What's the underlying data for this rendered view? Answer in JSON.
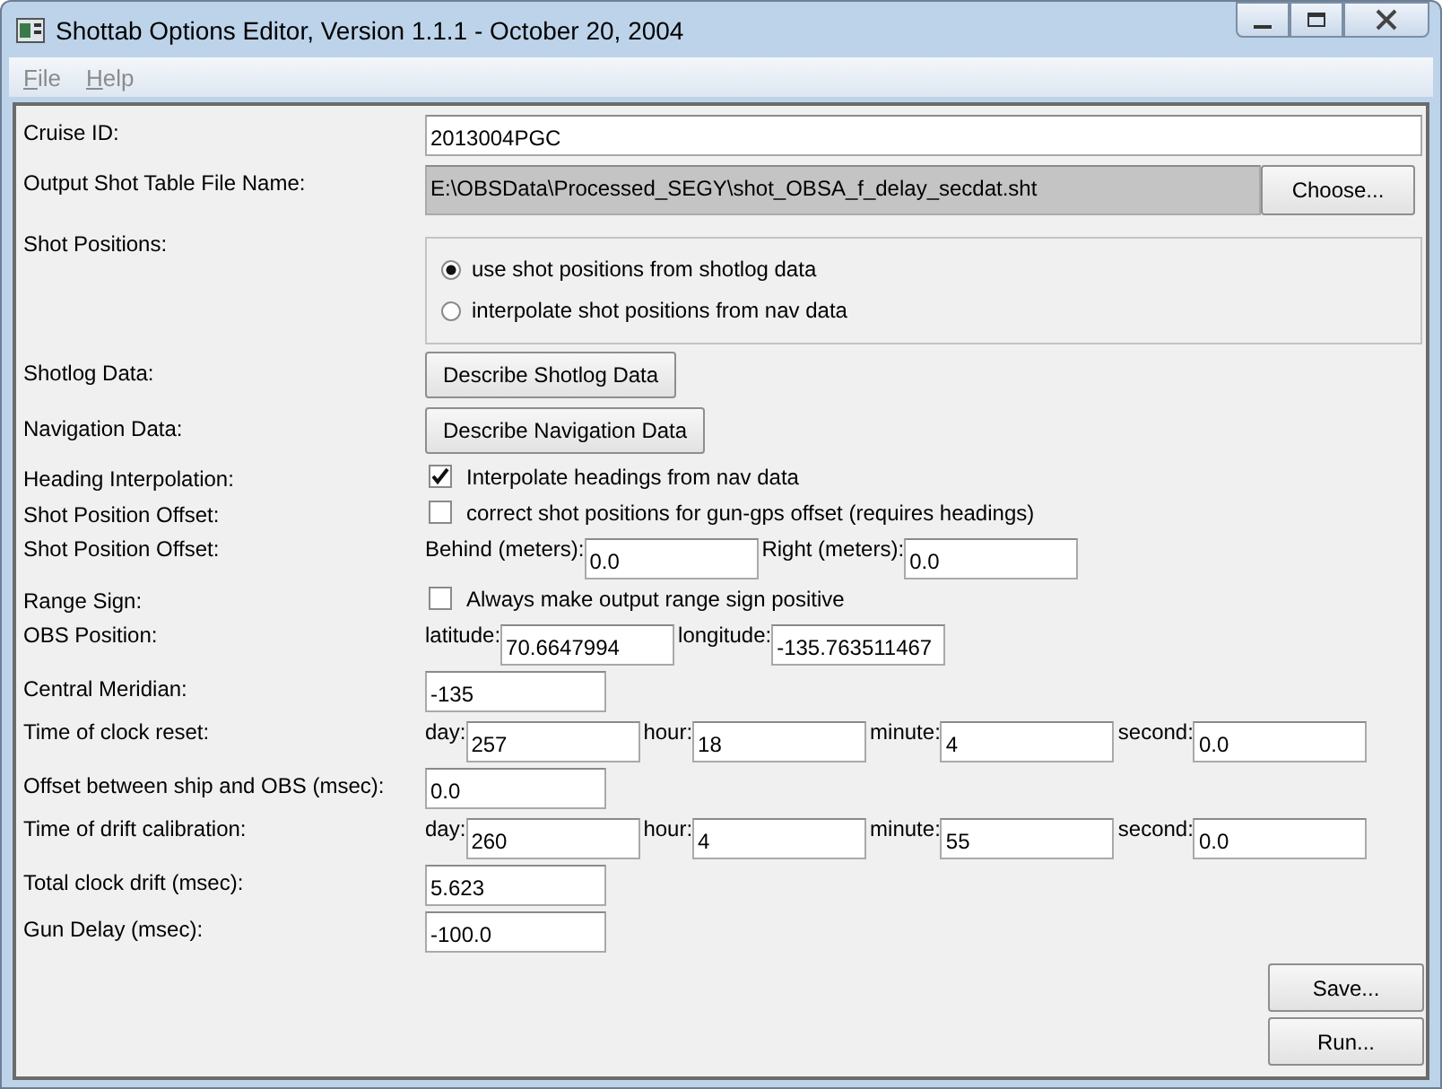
{
  "window": {
    "title": "Shottab Options Editor, Version 1.1.1 - October 20, 2004"
  },
  "menu": [
    "File",
    "Help"
  ],
  "rows": [
    {
      "kind": "long_field",
      "label": "Cruise ID:",
      "value": "2013004PGC"
    },
    {
      "kind": "file",
      "label": "Output Shot Table File Name:",
      "value": "E:\\OBSData\\Processed_SEGY\\shot_OBSA_f_delay_secdat.sht",
      "button": "Choose..."
    },
    {
      "kind": "radio",
      "label": "Shot Positions:",
      "options": [
        {
          "label": "use shot positions from shotlog data",
          "selected": true
        },
        {
          "label": "interpolate shot positions from nav data",
          "selected": false
        }
      ]
    },
    {
      "kind": "button",
      "label": "Shotlog Data:",
      "button": "Describe Shotlog Data"
    },
    {
      "kind": "button",
      "label": "Navigation Data:",
      "button": "Describe Navigation Data"
    },
    {
      "kind": "check",
      "label": "Heading Interpolation:",
      "text": "Interpolate headings from nav data",
      "checked": true
    },
    {
      "kind": "check",
      "label": "Shot Position Offset:",
      "text": "correct shot positions for gun-gps offset (requires headings)",
      "checked": false
    },
    {
      "kind": "fields",
      "label": "Shot Position Offset:",
      "parts": [
        {
          "prefix": "Behind (meters):",
          "value": "0.0"
        },
        {
          "prefix": "Right (meters):",
          "value": "0.0"
        }
      ]
    },
    {
      "kind": "check",
      "label": "Range Sign:",
      "text": "Always make output range sign positive",
      "checked": false
    },
    {
      "kind": "fields",
      "label": "OBS Position:",
      "parts": [
        {
          "prefix": "latitude:",
          "value": "70.6647994"
        },
        {
          "prefix": "longitude:",
          "value": "-135.763511467"
        }
      ]
    },
    {
      "kind": "field",
      "label": "Central Meridian:",
      "value": "-135"
    },
    {
      "kind": "fields",
      "label": "Time of clock reset:",
      "parts": [
        {
          "prefix": "day:",
          "value": "257"
        },
        {
          "prefix": "hour:",
          "value": "18"
        },
        {
          "prefix": "minute:",
          "value": "4"
        },
        {
          "prefix": "second:",
          "value": "0.0"
        }
      ]
    },
    {
      "kind": "field",
      "label": "Offset between ship and OBS (msec):",
      "value": "0.0"
    },
    {
      "kind": "fields",
      "label": "Time of drift calibration:",
      "parts": [
        {
          "prefix": "day:",
          "value": "260"
        },
        {
          "prefix": "hour:",
          "value": "4"
        },
        {
          "prefix": "minute:",
          "value": "55"
        },
        {
          "prefix": "second:",
          "value": "0.0"
        }
      ]
    },
    {
      "kind": "field",
      "label": "Total clock drift (msec):",
      "value": "5.623"
    },
    {
      "kind": "field",
      "label": "Gun Delay (msec):",
      "value": "-100.0"
    }
  ],
  "buttons": [
    "Save...",
    "Run..."
  ]
}
